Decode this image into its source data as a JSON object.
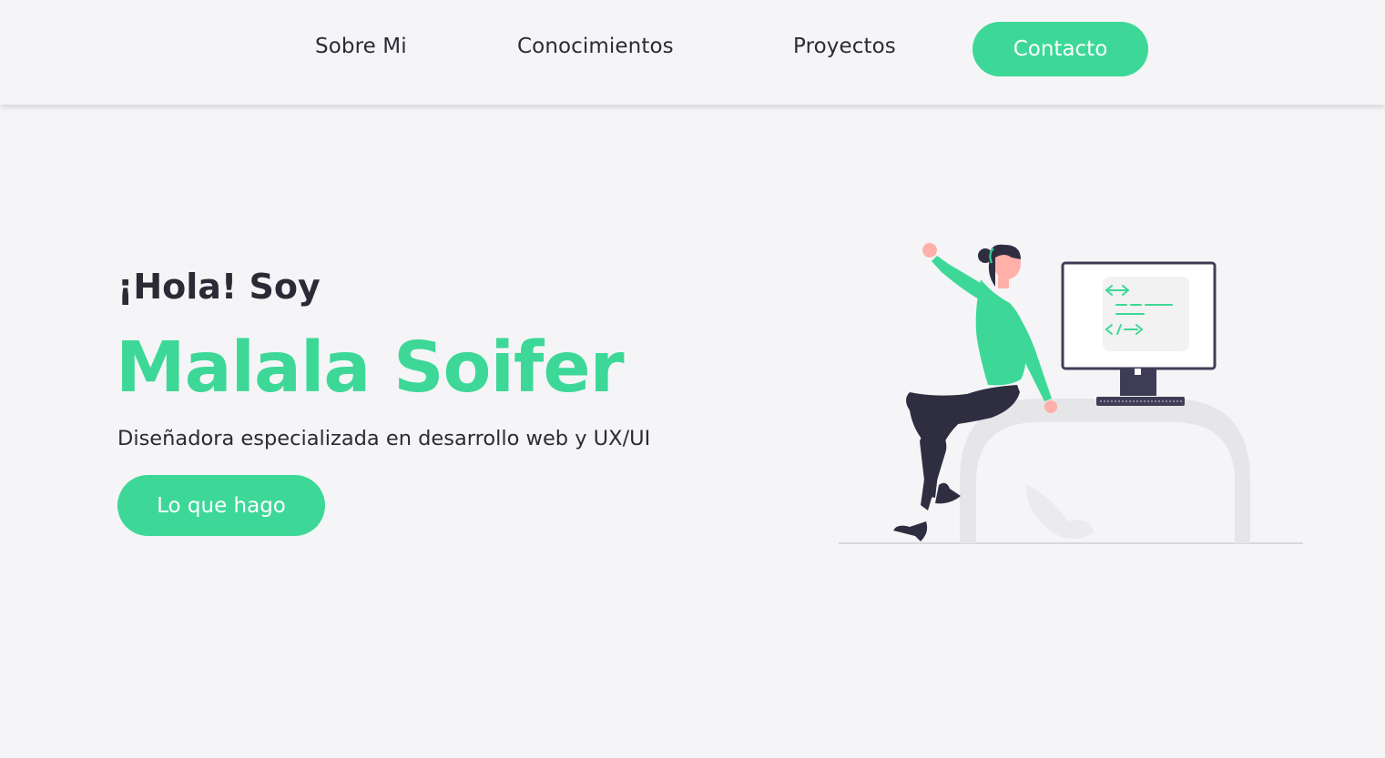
{
  "nav": {
    "items": [
      {
        "label": "Sobre Mi"
      },
      {
        "label": "Conocimientos"
      },
      {
        "label": "Proyectos"
      }
    ],
    "contact_label": "Contacto"
  },
  "hero": {
    "greeting": "¡Hola! Soy",
    "name": "Malala Soifer",
    "subtitle": "Diseñadora especializada en desarrollo web y UX/UI",
    "cta_label": "Lo que hago",
    "illustration_icon": "woman-sitting-on-desk-with-computer-illustration"
  },
  "colors": {
    "accent": "#3dd897",
    "background": "#f5f5f7",
    "text": "#2b2b35",
    "dark": "#2f2e41"
  }
}
